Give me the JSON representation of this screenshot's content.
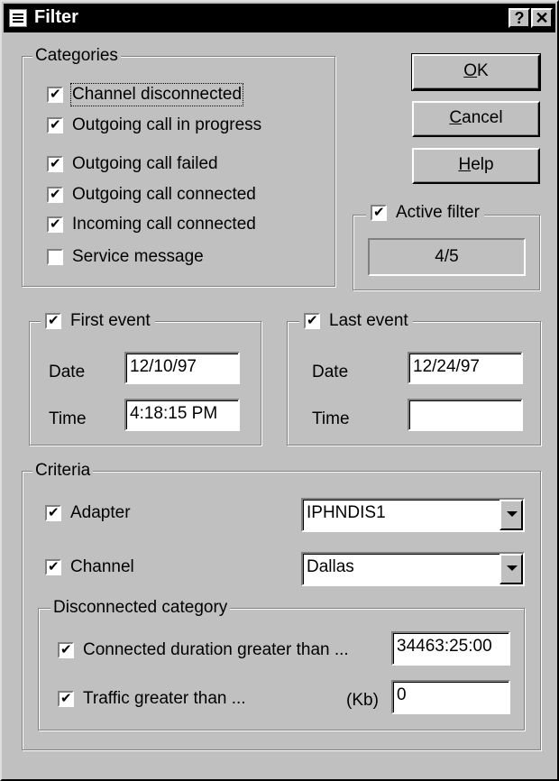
{
  "window": {
    "title": "Filter",
    "help_glyph": "?",
    "close_glyph": "✕"
  },
  "categories": {
    "legend": "Categories",
    "items": [
      {
        "label": "Channel disconnected",
        "checked": true
      },
      {
        "label": "Outgoing call in progress",
        "checked": true
      },
      {
        "label": "Outgoing call failed",
        "checked": true
      },
      {
        "label": "Outgoing call connected",
        "checked": true
      },
      {
        "label": "Incoming call connected",
        "checked": true
      },
      {
        "label": "Service message",
        "checked": false
      }
    ]
  },
  "buttons": {
    "ok_mn": "O",
    "ok_rest": "K",
    "cancel_mn": "C",
    "cancel_rest": "ancel",
    "help_mn": "H",
    "help_rest": "elp"
  },
  "active_filter": {
    "label": "Active filter",
    "checked": true,
    "value": "4/5"
  },
  "first_event": {
    "label": "First event",
    "checked": true,
    "date_label": "Date",
    "date": "12/10/97",
    "time_label": "Time",
    "time": "4:18:15 PM"
  },
  "last_event": {
    "label": "Last event",
    "checked": true,
    "date_label": "Date",
    "date": "12/24/97",
    "time_label": "Time",
    "time": ""
  },
  "criteria": {
    "legend": "Criteria",
    "adapter": {
      "label": "Adapter",
      "checked": true,
      "value": "IPHNDIS1"
    },
    "channel": {
      "label": "Channel",
      "checked": true,
      "value": "Dallas"
    },
    "disconnected": {
      "legend": "Disconnected category",
      "duration_label": "Connected duration greater than ...",
      "duration_checked": true,
      "duration_value": "34463:25:00",
      "traffic_label": "Traffic greater than ...",
      "traffic_checked": true,
      "traffic_unit": "(Kb)",
      "traffic_value": "0"
    }
  }
}
